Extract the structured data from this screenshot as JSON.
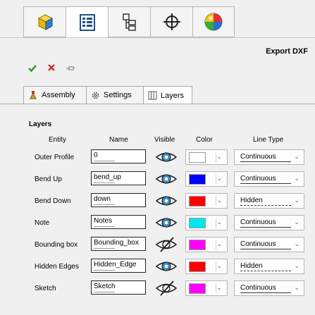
{
  "toolbar": {
    "buttons": [
      {
        "icon": "part-cube-icon"
      },
      {
        "icon": "property-manager-icon"
      },
      {
        "icon": "configuration-manager-icon"
      },
      {
        "icon": "crosshair-icon"
      },
      {
        "icon": "appearance-sphere-icon"
      }
    ]
  },
  "panel": {
    "title": "Export DXF"
  },
  "actions": {
    "ok": "✔",
    "cancel": "✖",
    "pin": "📌"
  },
  "tabs": [
    {
      "label": "Assembly",
      "icon": "assembly-icon"
    },
    {
      "label": "Settings",
      "icon": "gear-icon"
    },
    {
      "label": "Layers",
      "icon": "layers-icon"
    }
  ],
  "layers": {
    "section": "Layers",
    "headers": {
      "entity": "Entity",
      "name": "Name",
      "visible": "Visible",
      "color": "Color",
      "linetype": "Line Type"
    },
    "rows": [
      {
        "entity": "Outer Profile",
        "name": "0",
        "visible": true,
        "color": "#ffffff",
        "linetype": "Continuous"
      },
      {
        "entity": "Bend Up",
        "name": "bend_up",
        "visible": true,
        "color": "#0000ff",
        "linetype": "Continuous"
      },
      {
        "entity": "Bend Down",
        "name": "down",
        "visible": true,
        "color": "#ff0000",
        "linetype": "Hidden"
      },
      {
        "entity": "Note",
        "name": "Notes",
        "visible": true,
        "color": "#00e5ee",
        "linetype": "Continuous"
      },
      {
        "entity": "Bounding box",
        "name": "Bounding_box",
        "visible": false,
        "color": "#ff00ff",
        "linetype": "Continuous"
      },
      {
        "entity": "Hidden Edges",
        "name": "Hidden_Edge",
        "visible": true,
        "color": "#ff0000",
        "linetype": "Hidden"
      },
      {
        "entity": "Sketch",
        "name": "Sketch",
        "visible": false,
        "color": "#ff00ff",
        "linetype": "Continuous"
      }
    ]
  }
}
